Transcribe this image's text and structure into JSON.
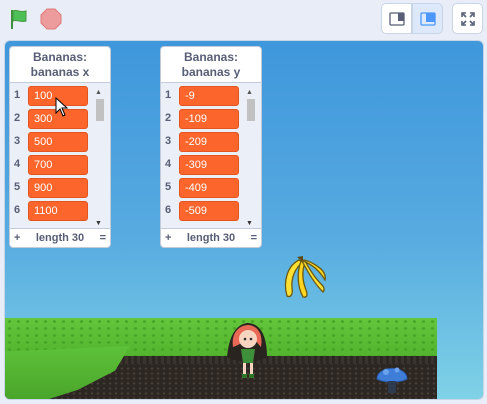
{
  "toolbar": {
    "green_flag": "green-flag-icon",
    "stop": "stop-icon",
    "small_stage": "small-stage-icon",
    "normal_stage": "normal-stage-icon",
    "fullscreen": "fullscreen-icon"
  },
  "colors": {
    "list_item": "#fc662c",
    "accent": "#4c97ff",
    "green_flag": "#4cbf56",
    "stop": "#ec9c9c"
  },
  "monitors": [
    {
      "title_line1": "Bananas:",
      "title_line2": "bananas x",
      "items": [
        {
          "index": "1",
          "value": "100"
        },
        {
          "index": "2",
          "value": "300"
        },
        {
          "index": "3",
          "value": "500"
        },
        {
          "index": "4",
          "value": "700"
        },
        {
          "index": "5",
          "value": "900"
        },
        {
          "index": "6",
          "value": "1100"
        }
      ],
      "add": "+",
      "length": "length 30",
      "resize": "="
    },
    {
      "title_line1": "Bananas:",
      "title_line2": "bananas y",
      "items": [
        {
          "index": "1",
          "value": "-9"
        },
        {
          "index": "2",
          "value": "-109"
        },
        {
          "index": "3",
          "value": "-209"
        },
        {
          "index": "4",
          "value": "-309"
        },
        {
          "index": "5",
          "value": "-409"
        },
        {
          "index": "6",
          "value": "-509"
        }
      ],
      "add": "+",
      "length": "length 30",
      "resize": "="
    }
  ]
}
